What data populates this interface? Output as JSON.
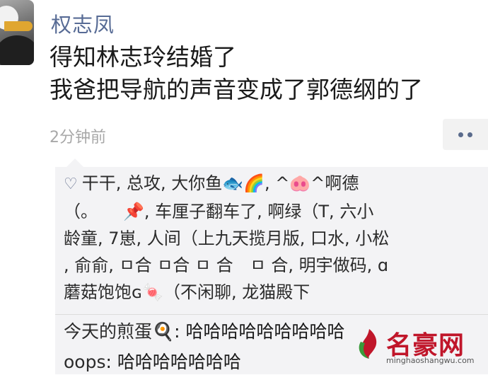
{
  "post": {
    "author": "权志凤",
    "lines": [
      "得知林志玲结婚了",
      "我爸把导航的声音变成了郭德纲的了"
    ],
    "time": "2分钟前"
  },
  "likes": {
    "lines": [
      "干干, 总攻, 大你鱼🐟🌈, ^🐽^啊德",
      "（。　　📌, 车厘子翻车了, 啊绿（T, 六小",
      "龄童, 7崽, 人间（上九天揽月版, 口水, 小松",
      ", 俞俞, ㅁ合 ㅁ合 ㅁ 合　ㅁ 合, 明宇做码, ɑ",
      "蘑菇饱饱ɢ🍬（不闲聊, 龙猫殿下"
    ]
  },
  "comments": [
    {
      "author": "今天的煎蛋🍳",
      "text": "哈哈哈哈哈哈哈哈哈"
    },
    {
      "author": "oops",
      "text": "哈哈哈哈哈哈哈"
    }
  ],
  "watermark": {
    "name": "名豪网",
    "url": "minghaoshangwu.com"
  },
  "colors": {
    "nickname": "#576b95",
    "panel": "#f3f3f5",
    "brand": "#c0162a"
  }
}
